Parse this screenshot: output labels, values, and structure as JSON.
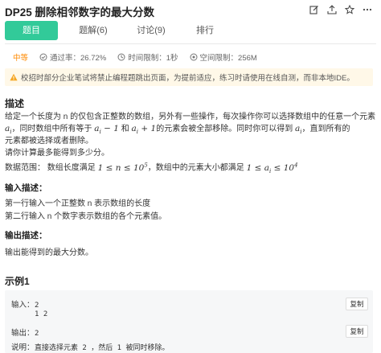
{
  "header": {
    "title": "DP25  删除相邻数字的最大分数",
    "icons": [
      "edit-icon",
      "share-icon",
      "star-icon",
      "more-icon"
    ]
  },
  "tabs": [
    {
      "label": "题目",
      "active": true
    },
    {
      "label": "题解(6)",
      "active": false
    },
    {
      "label": "讨论(9)",
      "active": false
    },
    {
      "label": "排行",
      "active": false
    }
  ],
  "meta": {
    "difficulty": "中等",
    "pass_rate": "通过率：26.72%",
    "time_limit": "时间限制：1秒",
    "space_limit": "空间限制：256M"
  },
  "notice": "校招时部分企业笔试将禁止编程题跳出页面，为提前适应，练习时请使用在线自测，而非本地IDE。",
  "description": {
    "title": "描述",
    "p1_a": "给定一个长度为 n 的仅包含正整数的数组，另外有一些操作，每次操作你可以选择数组中的任意一个元素",
    "p1_b_start": "，同时数组中所有等于",
    "p1_b_and": "和",
    "p1_b_end": "的元素会被全部移除。同时你可以得到",
    "p1_b_tail": "，直到所有的",
    "p1_c": "元素都被选择或者删除。",
    "p2": "请你计算最多能得到多少分。",
    "p3_a": "数据范围：  数组长度满足",
    "p3_b": "，数组中的元素大小都满足",
    "colors": {
      "accent": "#32ca99",
      "difficulty": "#ff8a00",
      "notice_bg": "#fff8e8"
    }
  },
  "input_desc": {
    "title": "输入描述：",
    "line1": "第一行输入一个正整数 n 表示数组的长度",
    "line2": "第二行输入 n 个数字表示数组的各个元素值。"
  },
  "output_desc": {
    "title": "输出描述：",
    "line1": "输出能得到的最大分数。"
  },
  "example": {
    "title": "示例1",
    "input_label": "输入：",
    "input_line1": "2",
    "input_line2": "1 2",
    "output_label": "输出：",
    "output_value": "2",
    "explain_label": "说明：",
    "explain_value": "直接选择元素 2 ，然后 1 被同时移除。",
    "copy_label": "复制"
  }
}
